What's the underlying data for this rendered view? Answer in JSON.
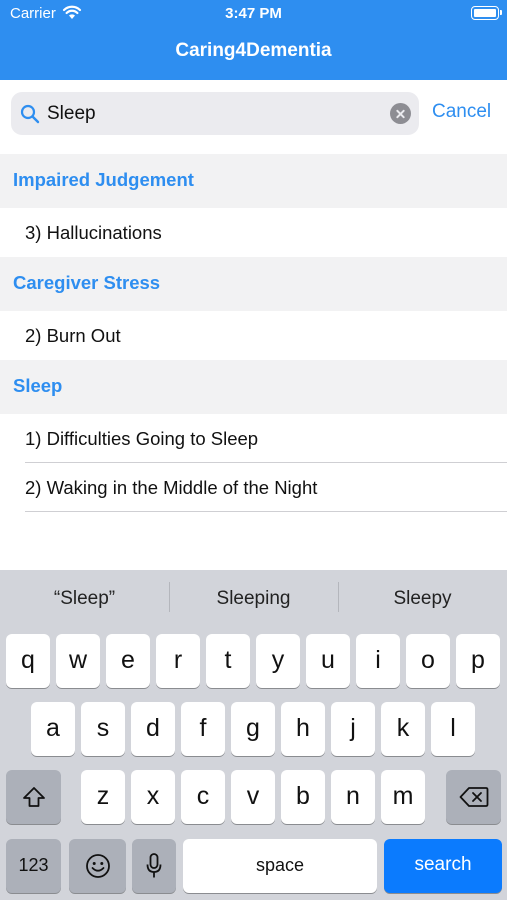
{
  "status": {
    "carrier": "Carrier",
    "time": "3:47 PM"
  },
  "nav": {
    "title": "Caring4Dementia"
  },
  "search": {
    "value": "Sleep",
    "cancel_label": "Cancel"
  },
  "colors": {
    "accent": "#2e8ef0",
    "keyboard_bg": "#d2d4da",
    "search_key": "#0b7bfe"
  },
  "sections": [
    {
      "title": "Impaired Judgement",
      "items": [
        "3) Hallucinations"
      ]
    },
    {
      "title": "Caregiver Stress",
      "items": [
        "2) Burn Out"
      ]
    },
    {
      "title": "Sleep",
      "items": [
        "1) Difficulties Going to Sleep",
        "2) Waking in the Middle of the Night"
      ]
    }
  ],
  "keyboard": {
    "suggestions": [
      "“Sleep”",
      "Sleeping",
      "Sleepy"
    ],
    "row1": [
      "q",
      "w",
      "e",
      "r",
      "t",
      "y",
      "u",
      "i",
      "o",
      "p"
    ],
    "row2": [
      "a",
      "s",
      "d",
      "f",
      "g",
      "h",
      "j",
      "k",
      "l"
    ],
    "row3": [
      "z",
      "x",
      "c",
      "v",
      "b",
      "n",
      "m"
    ],
    "numbers_label": "123",
    "space_label": "space",
    "search_label": "search",
    "icons": [
      "shift-icon",
      "delete-icon",
      "emoji-icon",
      "microphone-icon"
    ]
  }
}
